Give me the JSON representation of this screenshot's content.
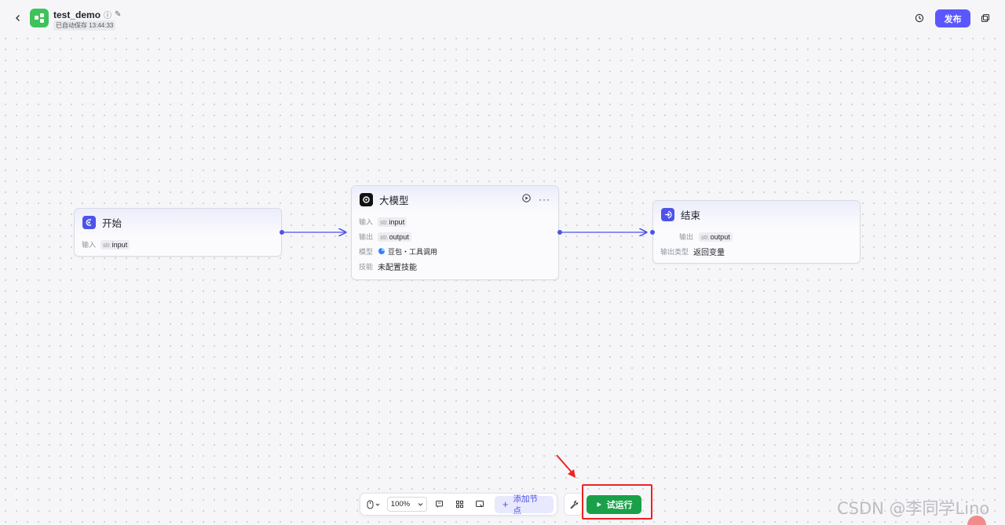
{
  "header": {
    "title": "test_demo",
    "autosave": "已自动保存 13:44:33",
    "publish_label": "发布"
  },
  "nodes": {
    "start": {
      "title": "开始",
      "rows": [
        {
          "key": "输入",
          "type": "str.",
          "value": "input"
        }
      ]
    },
    "llm": {
      "title": "大模型",
      "input_key": "输入",
      "input_type": "str.",
      "input_value": "input",
      "output_key": "输出",
      "output_type": "str.",
      "output_value": "output",
      "model_key": "模型",
      "model_value": "豆包・工具调用",
      "skill_key": "技能",
      "skill_value": "未配置技能"
    },
    "end": {
      "title": "结束",
      "output_key": "输出",
      "output_type": "str.",
      "output_value": "output",
      "output_type_key": "输出类型",
      "output_type_value": "返回变量"
    }
  },
  "toolbar": {
    "zoom": "100%",
    "add_node_label": "添加节点",
    "run_label": "试运行"
  },
  "watermark": "CSDN @李同学Lino",
  "colors": {
    "accent": "#4d53e8",
    "publish": "#5b57ff",
    "run": "#1aa048",
    "highlight": "#ee2222",
    "app_icon": "#3ec25a"
  }
}
